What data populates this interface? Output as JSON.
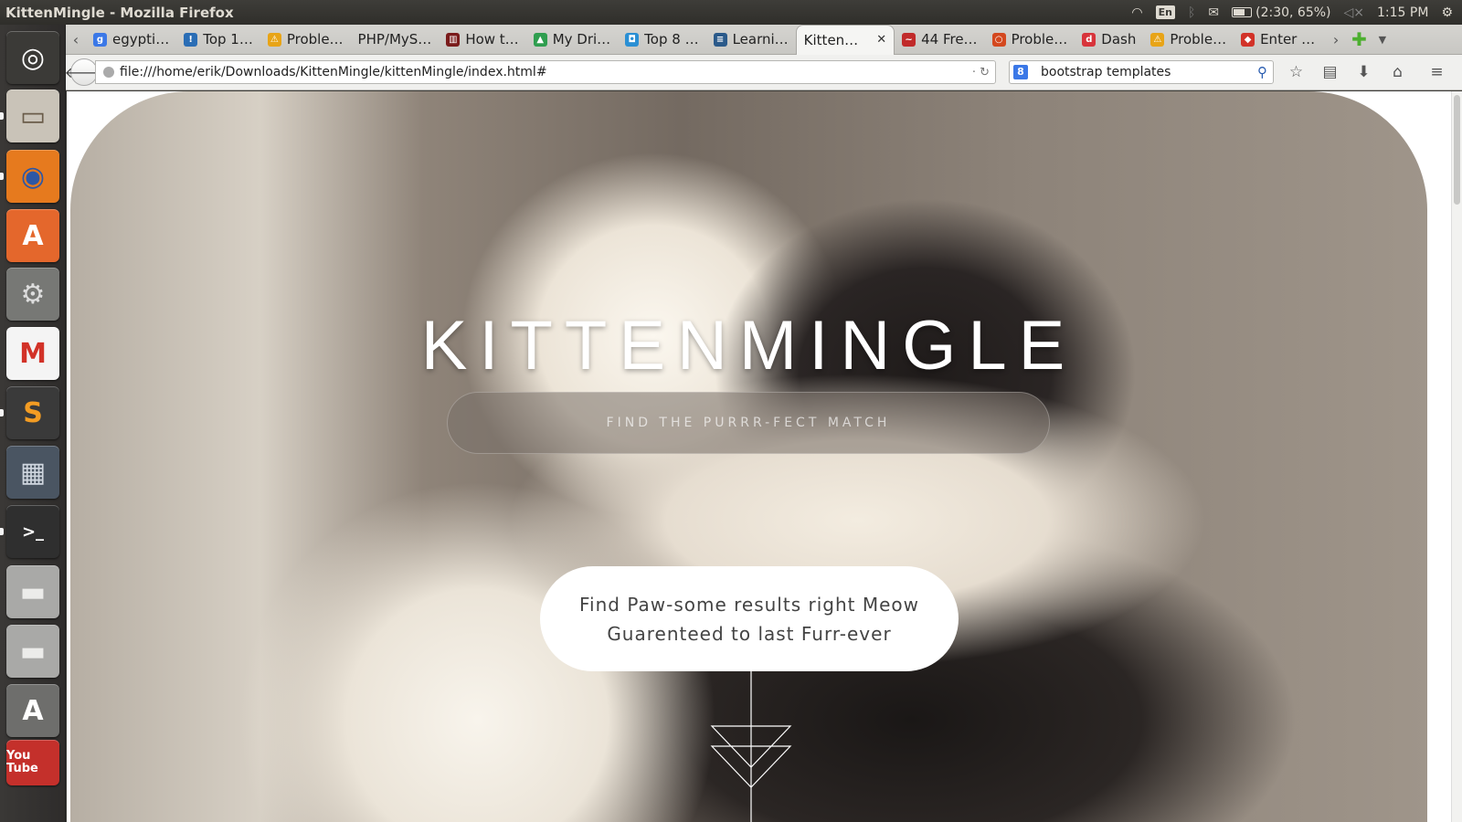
{
  "system": {
    "window_title": "KittenMingle - Mozilla Firefox",
    "keyboard": "En",
    "battery": "(2:30, 65%)",
    "clock": "1:15 PM"
  },
  "launcher": {
    "items": [
      {
        "name": "ubuntu-dash-icon",
        "label": "",
        "bg": "#3b3a37",
        "fg": "#ffffff",
        "glyph": "◎"
      },
      {
        "name": "files-icon",
        "label": "",
        "bg": "#c9c3b8",
        "fg": "#6a5c4a",
        "glyph": "▭"
      },
      {
        "name": "firefox-icon",
        "label": "",
        "bg": "#e67a1e",
        "fg": "#2d57a5",
        "glyph": "◉"
      },
      {
        "name": "software-center-icon",
        "label": "",
        "bg": "#e4672c",
        "fg": "#ffffff",
        "glyph": "A"
      },
      {
        "name": "system-settings-icon",
        "label": "",
        "bg": "#777875",
        "fg": "#dddddd",
        "glyph": "⚙"
      },
      {
        "name": "gmail-icon",
        "label": "",
        "bg": "#f4f4f4",
        "fg": "#d23228",
        "glyph": "M"
      },
      {
        "name": "sublime-text-icon",
        "label": "",
        "bg": "#3a3a3a",
        "fg": "#f39c23",
        "glyph": "S"
      },
      {
        "name": "workspace-switcher-icon",
        "label": "",
        "bg": "#4a5562",
        "fg": "#cfd6df",
        "glyph": "▦"
      },
      {
        "name": "terminal-icon",
        "label": "",
        "bg": "#2f2f2f",
        "fg": "#ffffff",
        "glyph": ">_"
      },
      {
        "name": "disk-drive-icon",
        "label": "",
        "bg": "#a9a9a7",
        "fg": "#ececea",
        "glyph": "▬"
      },
      {
        "name": "disk-drive-2-icon",
        "label": "",
        "bg": "#a9a9a7",
        "fg": "#ececea",
        "glyph": "▬"
      },
      {
        "name": "software-updater-icon",
        "label": "",
        "bg": "#6e6e6c",
        "fg": "#ffffff",
        "glyph": "A"
      },
      {
        "name": "youtube-icon",
        "label": "You Tube",
        "bg": "#c4302b",
        "fg": "#ffffff",
        "glyph": ""
      }
    ]
  },
  "tabs": [
    {
      "label": "egypti…",
      "icon_color": "#3b78e7",
      "icon_glyph": "g"
    },
    {
      "label": "Top 1…",
      "icon_color": "#2a6db5",
      "icon_glyph": "!"
    },
    {
      "label": "Proble…",
      "icon_color": "#e8a417",
      "icon_glyph": "⚠"
    },
    {
      "label": "PHP/MyS…",
      "icon_color": "",
      "icon_glyph": ""
    },
    {
      "label": "How t…",
      "icon_color": "#7a1b1b",
      "icon_glyph": "▥"
    },
    {
      "label": "My Dri…",
      "icon_color": "#2f9e4f",
      "icon_glyph": "▲"
    },
    {
      "label": "Top 8 …",
      "icon_color": "#2a8fd4",
      "icon_glyph": "◘"
    },
    {
      "label": "Learni…",
      "icon_color": "#2b5a8a",
      "icon_glyph": "≡"
    },
    {
      "label": "Kitten…",
      "icon_color": "",
      "icon_glyph": "",
      "active": true
    },
    {
      "label": "44 Fre…",
      "icon_color": "#c12a2a",
      "icon_glyph": "~"
    },
    {
      "label": "Proble…",
      "icon_color": "#d4481e",
      "icon_glyph": "○"
    },
    {
      "label": "Dash",
      "icon_color": "#d8343b",
      "icon_glyph": "d"
    },
    {
      "label": "Proble…",
      "icon_color": "#e8a417",
      "icon_glyph": "⚠"
    },
    {
      "label": "Enter …",
      "icon_color": "#d23228",
      "icon_glyph": "◆"
    }
  ],
  "navbar": {
    "url": "file:///home/erik/Downloads/KittenMingle/kittenMingle/index.html#",
    "search_value": "bootstrap templates",
    "search_engine_glyph": "8"
  },
  "page": {
    "title": "KITTENMINGLE",
    "tagline": "FIND THE PURRR-FECT MATCH",
    "cta_line1": "Find Paw-some results right Meow",
    "cta_line2": "Guarenteed to last Furr-ever"
  }
}
